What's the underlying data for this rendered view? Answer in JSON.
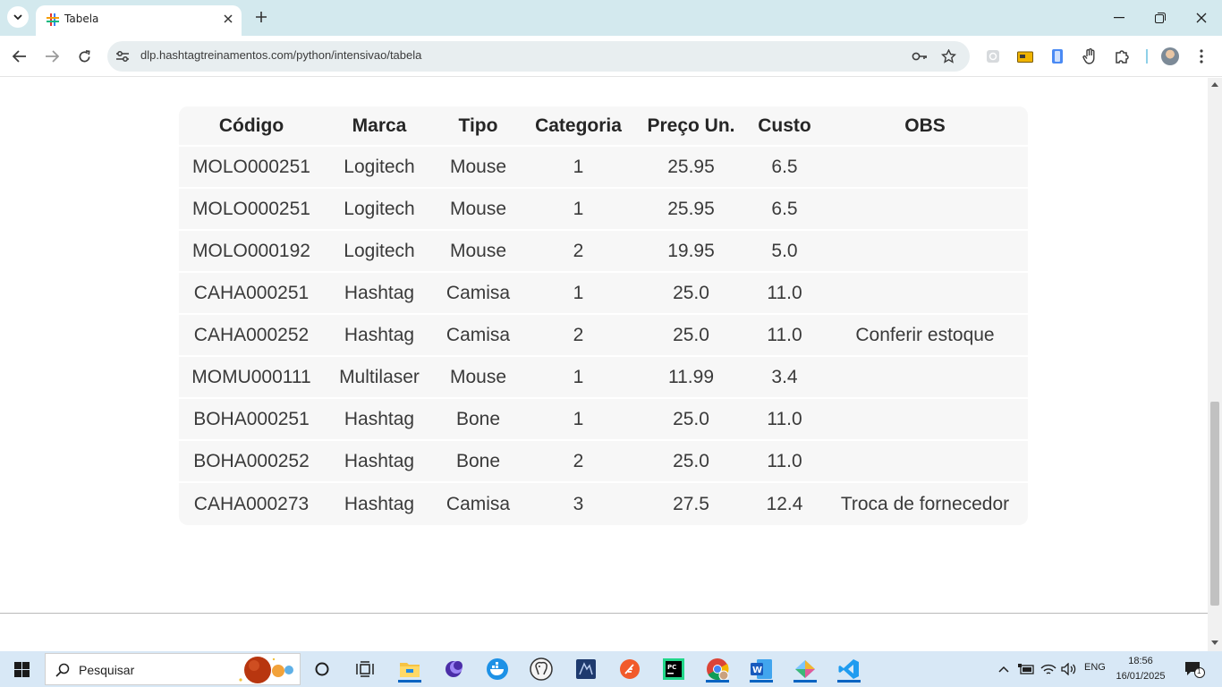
{
  "browser": {
    "tab": {
      "title": "Tabela"
    },
    "url": "dlp.hashtagtreinamentos.com/python/intensivao/tabela"
  },
  "table": {
    "headers": [
      "Código",
      "Marca",
      "Tipo",
      "Categoria",
      "Preço Un.",
      "Custo",
      "OBS"
    ],
    "rows": [
      [
        "MOLO000251",
        "Logitech",
        "Mouse",
        "1",
        "25.95",
        "6.5",
        ""
      ],
      [
        "MOLO000251",
        "Logitech",
        "Mouse",
        "1",
        "25.95",
        "6.5",
        ""
      ],
      [
        "MOLO000192",
        "Logitech",
        "Mouse",
        "2",
        "19.95",
        "5.0",
        ""
      ],
      [
        "CAHA000251",
        "Hashtag",
        "Camisa",
        "1",
        "25.0",
        "11.0",
        ""
      ],
      [
        "CAHA000252",
        "Hashtag",
        "Camisa",
        "2",
        "25.0",
        "11.0",
        "Conferir estoque"
      ],
      [
        "MOMU000111",
        "Multilaser",
        "Mouse",
        "1",
        "11.99",
        "3.4",
        ""
      ],
      [
        "BOHA000251",
        "Hashtag",
        "Bone",
        "1",
        "25.0",
        "11.0",
        ""
      ],
      [
        "BOHA000252",
        "Hashtag",
        "Bone",
        "2",
        "25.0",
        "11.0",
        ""
      ],
      [
        "CAHA000273",
        "Hashtag",
        "Camisa",
        "3",
        "27.5",
        "12.4",
        "Troca de fornecedor"
      ]
    ]
  },
  "taskbar": {
    "search_placeholder": "Pesquisar",
    "apps": [
      "task-view",
      "widgets",
      "file-explorer",
      "app-purple",
      "docker",
      "postgres",
      "terminal",
      "app-orange",
      "pycharm",
      "chrome",
      "word",
      "app-diamond",
      "vscode"
    ],
    "tray": {
      "language": "ENG",
      "time": "18:56",
      "date": "16/01/2025",
      "notifications": "1"
    }
  },
  "colors": {
    "tabstrip": "#d3e9ee",
    "table_bg": "#f7f7f7",
    "taskbar": "#d8e8f6",
    "accent": "#0a64c2"
  }
}
